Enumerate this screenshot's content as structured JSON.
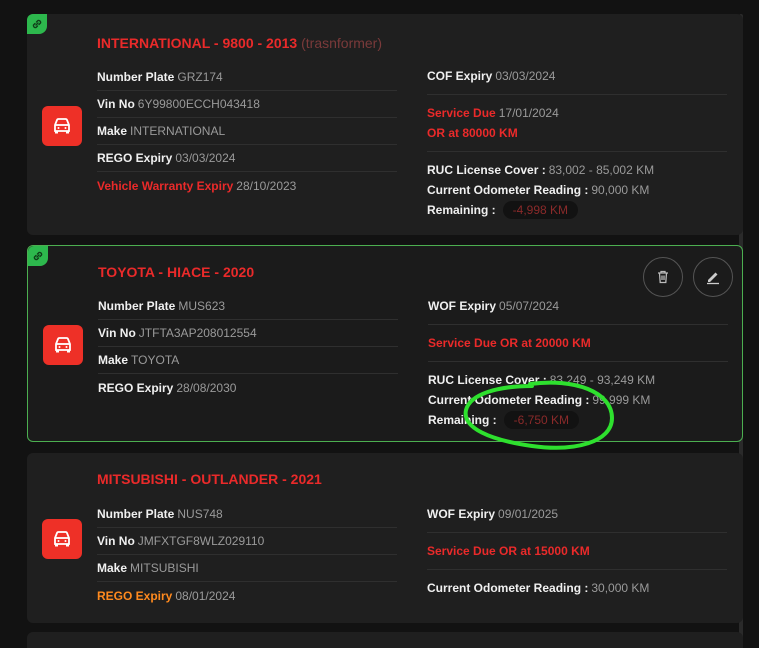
{
  "vehicles": [
    {
      "title": "INTERNATIONAL - 9800 - 2013",
      "subtitle": "(trasnformer)",
      "left": [
        {
          "label": "Number Plate",
          "value": "GRZ174"
        },
        {
          "label": "Vin No",
          "value": "6Y99800ECCH043418"
        },
        {
          "label": "Make",
          "value": "INTERNATIONAL"
        },
        {
          "label": "REGO Expiry",
          "value": "03/03/2024"
        },
        {
          "label": "Vehicle Warranty Expiry",
          "value": "28/10/2023"
        }
      ],
      "cof": {
        "label": "COF Expiry",
        "value": "03/03/2024"
      },
      "service_line1_label": "Service Due",
      "service_line1_value": "17/01/2024",
      "service_line2": "OR at 80000 KM",
      "ruc": {
        "label": "RUC License Cover :",
        "value": "83,002 - 85,002 KM"
      },
      "odometer": {
        "label": "Current Odometer Reading :",
        "value": "90,000 KM"
      },
      "remaining": {
        "label": "Remaining :",
        "value": "-4,998 KM"
      }
    },
    {
      "title": "TOYOTA - HIACE - 2020",
      "left": [
        {
          "label": "Number Plate",
          "value": "MUS623"
        },
        {
          "label": "Vin No",
          "value": "JTFTA3AP208012554"
        },
        {
          "label": "Make",
          "value": "TOYOTA"
        },
        {
          "label": "REGO Expiry",
          "value": "28/08/2030"
        }
      ],
      "wof": {
        "label": "WOF Expiry",
        "value": "05/07/2024"
      },
      "service": "Service Due OR at 20000 KM",
      "ruc": {
        "label": "RUC License Cover :",
        "value": "83,249 - 93,249 KM"
      },
      "odometer": {
        "label": "Current Odometer Reading :",
        "value": "99,999 KM"
      },
      "remaining": {
        "label": "Remaining :",
        "value": "-6,750 KM"
      }
    },
    {
      "title": "MITSUBISHI - OUTLANDER - 2021",
      "left": [
        {
          "label": "Number Plate",
          "value": "NUS748"
        },
        {
          "label": "Vin No",
          "value": "JMFXTGF8WLZ029110"
        },
        {
          "label": "Make",
          "value": "MITSUBISHI"
        },
        {
          "label": "REGO Expiry",
          "value": "08/01/2024"
        }
      ],
      "wof": {
        "label": "WOF Expiry",
        "value": "09/01/2025"
      },
      "service": "Service Due OR at 15000 KM",
      "odometer": {
        "label": "Current Odometer Reading :",
        "value": "30,000 KM"
      }
    }
  ],
  "icons": {
    "link": "link-icon",
    "vehicle": "car-icon",
    "delete": "trash-icon",
    "edit": "pencil-icon"
  },
  "colors": {
    "accent_red": "#ea2a2a",
    "warning_orange": "#ff8a1e",
    "selected_border": "#4caf50",
    "annotation": "#2ee02e"
  }
}
